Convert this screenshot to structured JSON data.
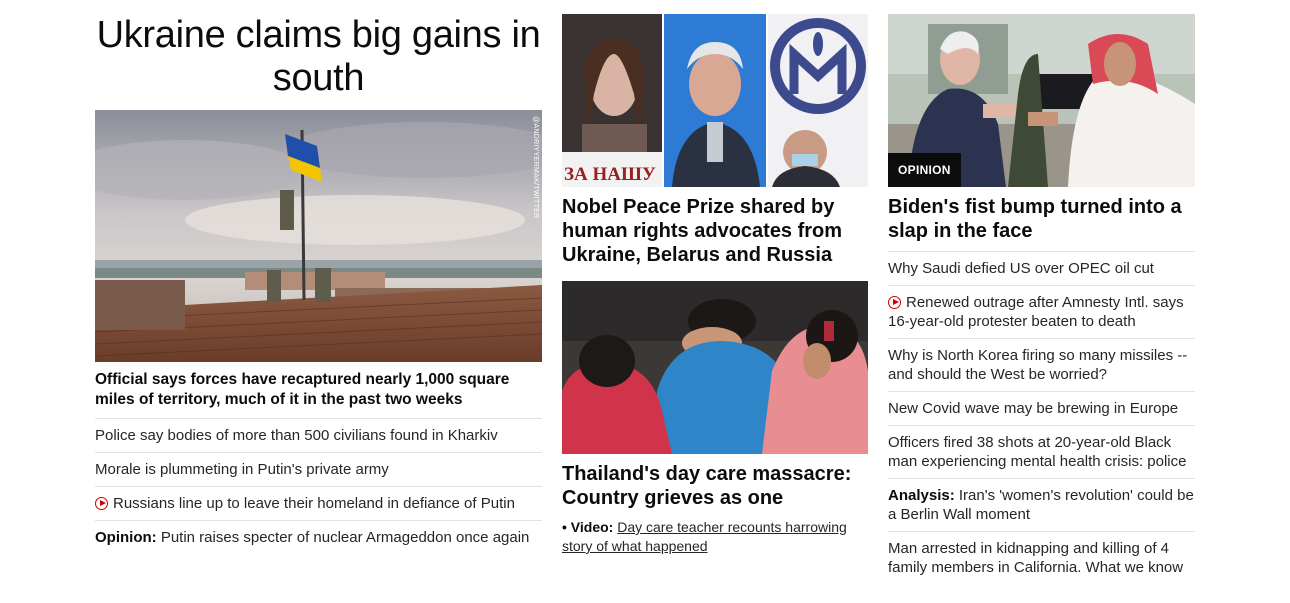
{
  "left": {
    "headline": "Ukraine claims big gains in south",
    "image_credit": "@ANDRIYYERMAK/TWITTER",
    "caption": "Official says forces have recaptured nearly 1,000 square miles of territory, much of it in the past two weeks",
    "links": [
      {
        "label": "",
        "text": "Police say bodies of more than 500 civilians found in Kharkiv",
        "video": false
      },
      {
        "label": "",
        "text": "Morale is plummeting in Putin's private army",
        "video": false
      },
      {
        "label": "",
        "text": "Russians line up to leave their homeland in defiance of Putin",
        "video": true
      },
      {
        "label": "Opinion:",
        "text": "Putin raises specter of nuclear Armageddon once again",
        "video": false
      }
    ]
  },
  "middle": {
    "story1": {
      "sign_text": "ЗА НАШУ",
      "headline": "Nobel Peace Prize shared by human rights advocates from Ukraine, Belarus and Russia"
    },
    "story2": {
      "headline": "Thailand's day care massacre: Country grieves as one",
      "video_label": "Video:",
      "video_text": "Day care teacher recounts harrowing story of what happened"
    }
  },
  "right": {
    "badge": "OPINION",
    "headline": "Biden's fist bump turned into a slap in the face",
    "links": [
      {
        "label": "",
        "text": "Why Saudi defied US over OPEC oil cut",
        "video": false
      },
      {
        "label": "",
        "text": "Renewed outrage after Amnesty Intl. says 16-year-old protester beaten to death",
        "video": true
      },
      {
        "label": "",
        "text": "Why is North Korea firing so many missiles -- and should the West be worried?",
        "video": false
      },
      {
        "label": "",
        "text": "New Covid wave may be brewing in Europe",
        "video": false
      },
      {
        "label": "",
        "text": "Officers fired 38 shots at 20-year-old Black man experiencing mental health crisis: police",
        "video": false
      },
      {
        "label": "Analysis:",
        "text": "Iran's 'women's revolution' could be a Berlin Wall moment",
        "video": false
      },
      {
        "label": "",
        "text": "Man arrested in kidnapping and killing of 4 family members in California. What we know",
        "video": false
      }
    ]
  },
  "colors": {
    "video_icon": "#cc0000",
    "divider": "#e1e1e1",
    "badge_bg": "#0c0c0c"
  }
}
